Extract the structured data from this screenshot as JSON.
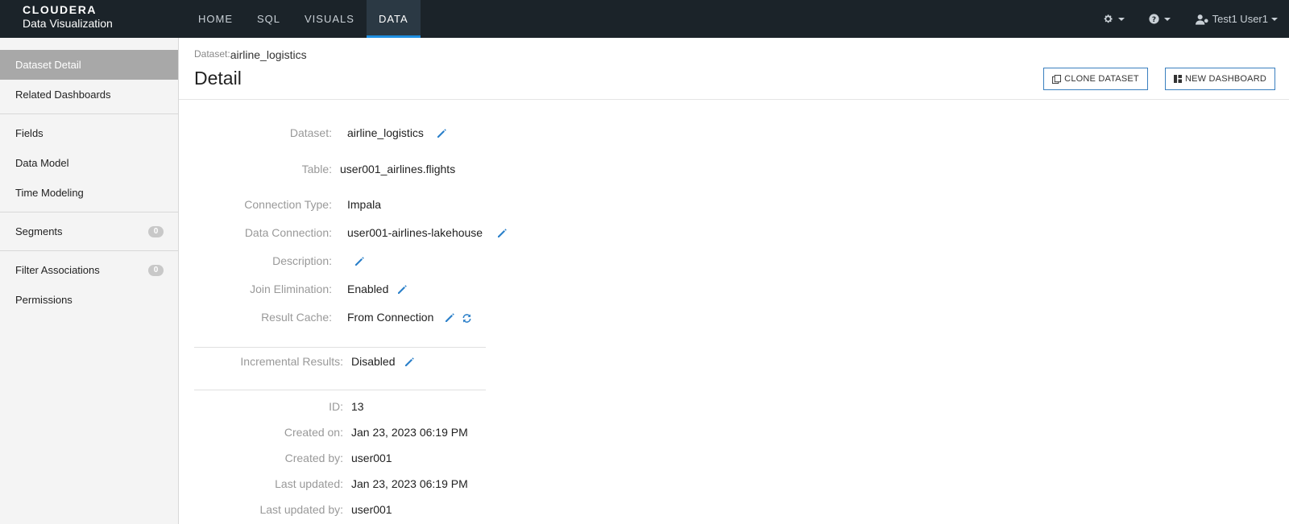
{
  "brand": {
    "line1": "CLOUDERA",
    "line2": "Data Visualization"
  },
  "nav": [
    {
      "label": "HOME"
    },
    {
      "label": "SQL"
    },
    {
      "label": "VISUALS"
    },
    {
      "label": "DATA"
    }
  ],
  "user": {
    "name": "Test1 User1"
  },
  "sidebar": {
    "items": [
      {
        "label": "Dataset Detail"
      },
      {
        "label": "Related Dashboards"
      },
      {
        "label": "Fields"
      },
      {
        "label": "Data Model"
      },
      {
        "label": "Time Modeling"
      },
      {
        "label": "Segments",
        "count": "0"
      },
      {
        "label": "Filter Associations",
        "count": "0"
      },
      {
        "label": "Permissions"
      }
    ]
  },
  "breadcrumb": {
    "label": "Dataset:",
    "value": "airline_logistics"
  },
  "page": {
    "title": "Detail"
  },
  "buttons": {
    "clone": "CLONE DATASET",
    "new_dashboard": "NEW DASHBOARD"
  },
  "details": {
    "dataset": {
      "label": "Dataset:",
      "value": "airline_logistics"
    },
    "table": {
      "label": "Table:",
      "value": "user001_airlines.flights"
    },
    "connection_type": {
      "label": "Connection Type:",
      "value": "Impala"
    },
    "data_connection": {
      "label": "Data Connection:",
      "value": "user001-airlines-lakehouse"
    },
    "description": {
      "label": "Description:",
      "value": ""
    },
    "join_elimination": {
      "label": "Join Elimination:",
      "value": "Enabled"
    },
    "result_cache": {
      "label": "Result Cache:",
      "value": "From Connection"
    },
    "incremental_results": {
      "label": "Incremental Results:",
      "value": "Disabled"
    },
    "id": {
      "label": "ID:",
      "value": "13"
    },
    "created_on": {
      "label": "Created on:",
      "value": "Jan 23, 2023 06:19 PM"
    },
    "created_by": {
      "label": "Created by:",
      "value": "user001"
    },
    "last_updated": {
      "label": "Last updated:",
      "value": "Jan 23, 2023 06:19 PM"
    },
    "last_updated_by": {
      "label": "Last updated by:",
      "value": "user001"
    }
  },
  "colors": {
    "navbar": "#1b2329",
    "accent": "#1e8fe1",
    "sidebar_active": "#a8a8a8"
  }
}
